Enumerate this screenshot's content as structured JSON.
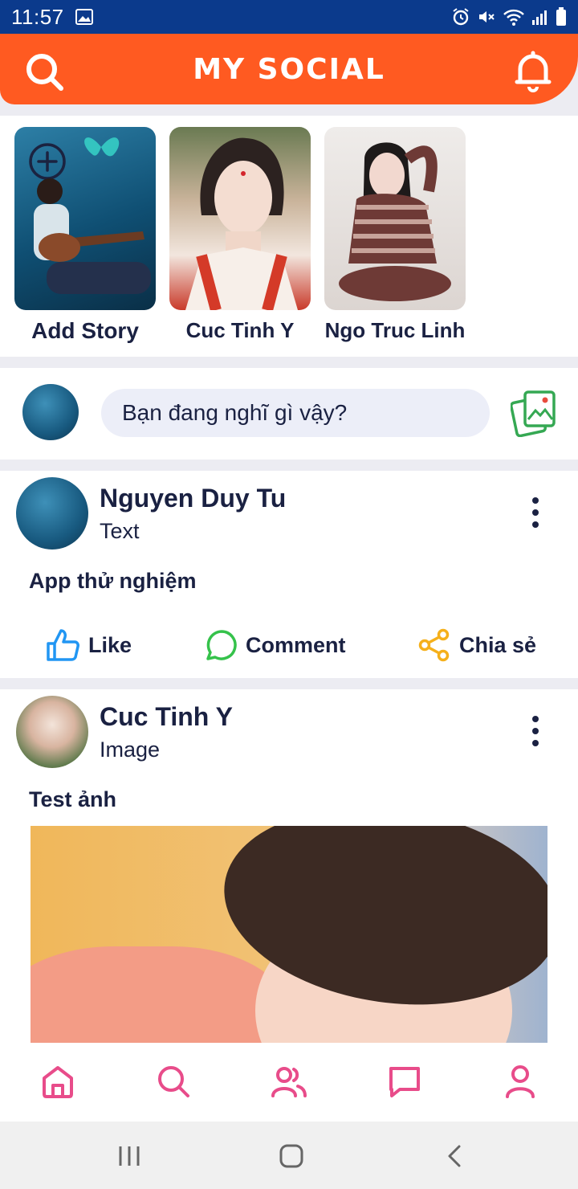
{
  "status_bar": {
    "time": "11:57"
  },
  "header": {
    "title": "MY SOCIAL"
  },
  "stories": [
    {
      "label": "Add Story"
    },
    {
      "label": "Cuc Tinh Y"
    },
    {
      "label": "Ngo Truc Linh"
    }
  ],
  "composer": {
    "placeholder": "Bạn đang nghĩ gì vậy?"
  },
  "posts": [
    {
      "author": "Nguyen Duy Tu",
      "type": "Text",
      "content": "App thử nghiệm",
      "actions": {
        "like": "Like",
        "comment": "Comment",
        "share": "Chia sẻ"
      }
    },
    {
      "author": "Cuc Tinh Y",
      "type": "Image",
      "content": "Test ảnh"
    }
  ],
  "colors": {
    "accent": "#ff5a21",
    "status_bar": "#0b3a8c",
    "nav_icon": "#e84c8a",
    "like": "#2196f3",
    "comment": "#35c24b",
    "share": "#f5b01b"
  }
}
